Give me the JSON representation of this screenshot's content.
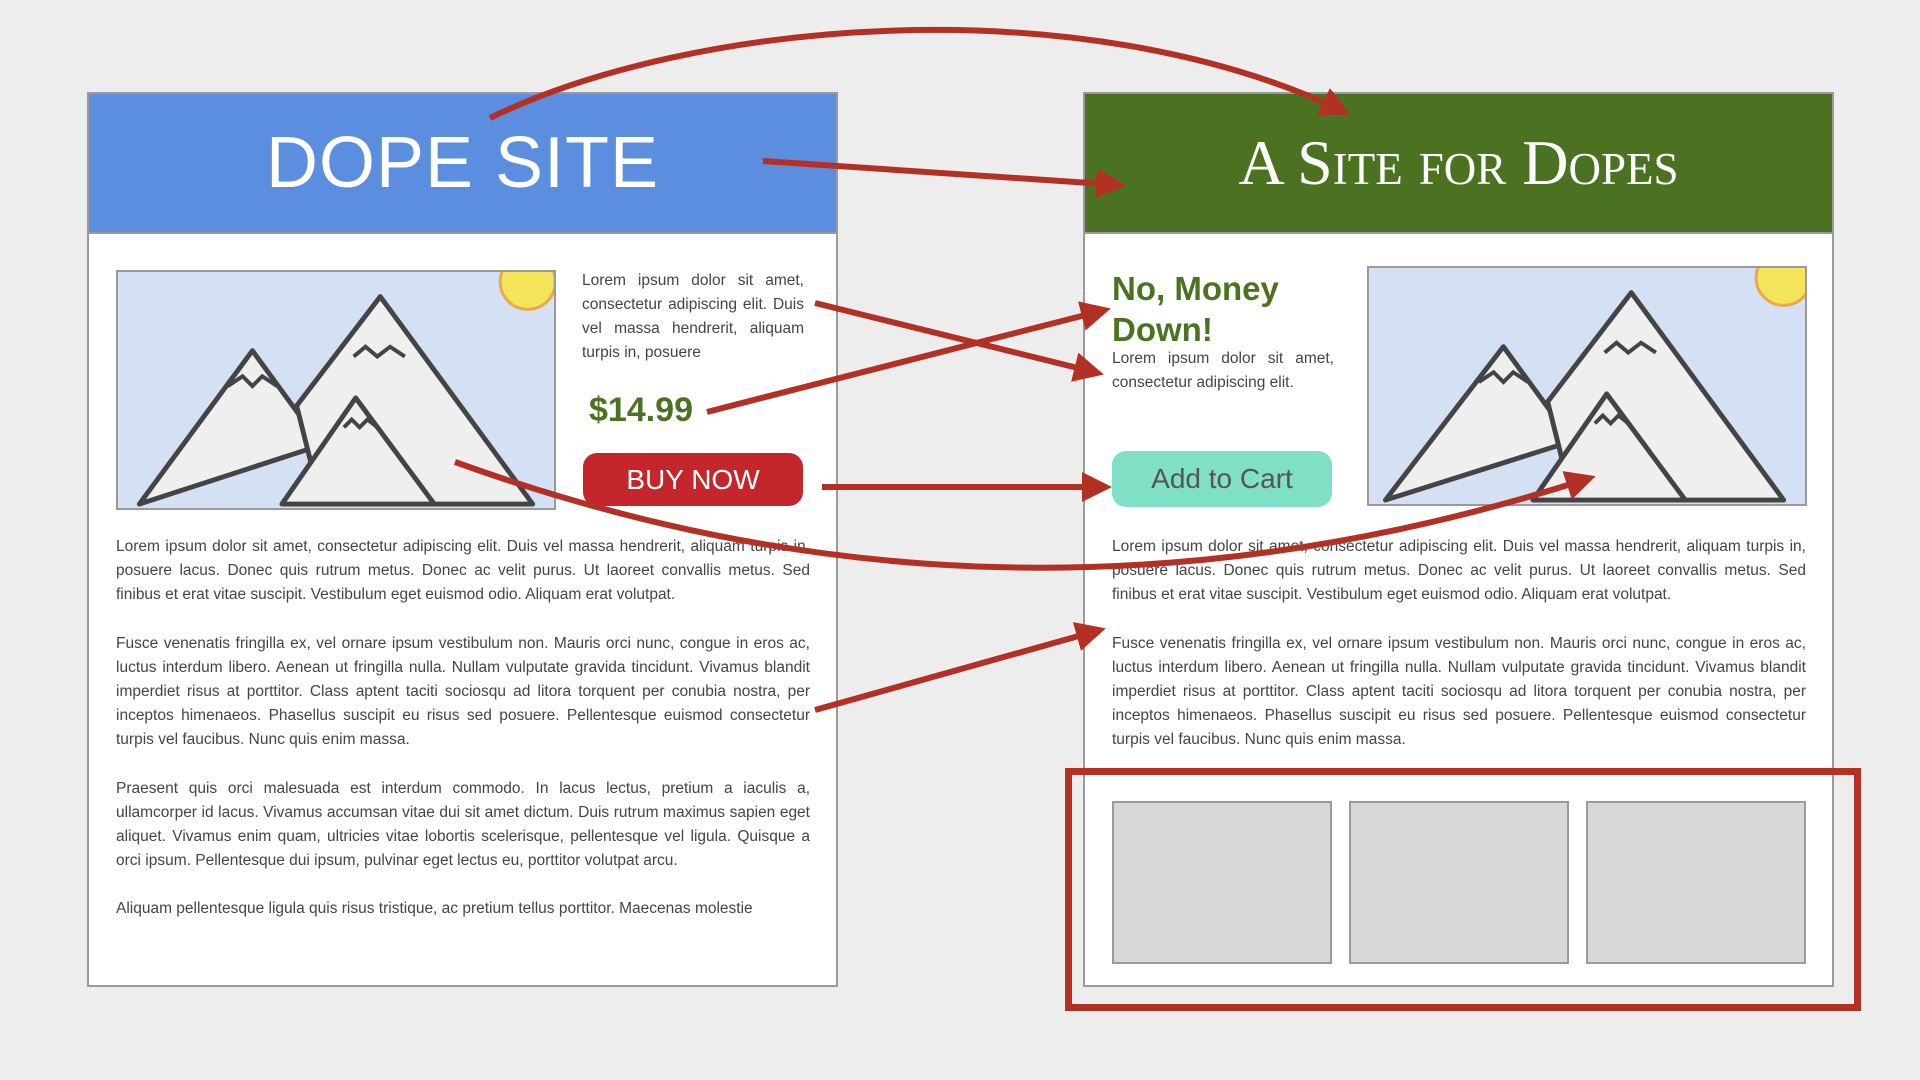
{
  "left_mockup": {
    "title": "DOPE SITE",
    "intro_text": "Lorem ipsum dolor sit amet, consectetur adipiscing elit. Duis vel massa hendrerit, aliquam turpis in, posuere",
    "price": "$14.99",
    "buy_button_label": "BUY NOW",
    "paragraphs": [
      "Lorem ipsum dolor sit amet, consectetur adipiscing elit. Duis vel massa hendrerit, aliquam turpis in, posuere lacus. Donec quis rutrum metus. Donec ac velit purus. Ut laoreet convallis metus. Sed finibus et erat vitae suscipit. Vestibulum eget euismod odio. Aliquam erat volutpat.",
      "Fusce venenatis fringilla ex, vel ornare ipsum vestibulum non. Mauris orci nunc, congue in eros ac, luctus interdum libero. Aenean ut fringilla nulla. Nullam vulputate gravida tincidunt. Vivamus blandit imperdiet risus at porttitor. Class aptent taciti sociosqu ad litora torquent per conubia nostra, per inceptos himenaeos. Phasellus suscipit eu risus sed posuere. Pellentesque euismod consectetur turpis vel faucibus. Nunc quis enim massa.",
      "Praesent quis orci malesuada est interdum commodo. In lacus lectus, pretium a iaculis a, ullamcorper id lacus. Vivamus accumsan vitae dui sit amet dictum. Duis rutrum maximus sapien eget aliquet. Vivamus enim quam, ultricies vitae lobortis scelerisque, pellentesque vel ligula. Quisque a orci ipsum. Pellentesque dui ipsum, pulvinar eget lectus eu, porttitor volutpat arcu.",
      "Aliquam pellentesque ligula quis risus tristique, ac pretium tellus porttitor. Maecenas molestie"
    ]
  },
  "right_mockup": {
    "title": "A Site for Dopes",
    "headline": "No, Money Down!",
    "intro_text": "Lorem ipsum dolor sit amet, consectetur adipiscing elit.",
    "cart_button_label": "Add to Cart",
    "paragraphs": [
      "Lorem ipsum dolor sit amet, consectetur adipiscing elit. Duis vel massa hendrerit, aliquam turpis in, posuere lacus. Donec quis rutrum metus. Donec ac velit purus. Ut laoreet convallis metus. Sed finibus et erat vitae suscipit. Vestibulum eget euismod odio. Aliquam erat volutpat.",
      "Fusce venenatis fringilla ex, vel ornare ipsum vestibulum non. Mauris orci nunc, congue in eros ac, luctus interdum libero. Aenean ut fringilla nulla. Nullam vulputate gravida tincidunt. Vivamus blandit imperdiet risus at porttitor. Class aptent taciti sociosqu ad litora torquent per conubia nostra, per inceptos himenaeos. Phasellus suscipit eu risus sed posuere. Pellentesque euismod consectetur turpis vel faucibus. Nunc quis enim massa."
    ],
    "thumbnail_count": 3
  },
  "colors": {
    "left_header": "#5b8ede",
    "right_header": "#4b7220",
    "price_green": "#4b7220",
    "buy_button": "#c4262b",
    "cart_button": "#7fe0c6",
    "arrow_red": "#b33024",
    "sky": "#d4e0f4",
    "sun": "#f3e45a"
  },
  "icons": [
    "mountain-image-icon",
    "sun-icon"
  ]
}
